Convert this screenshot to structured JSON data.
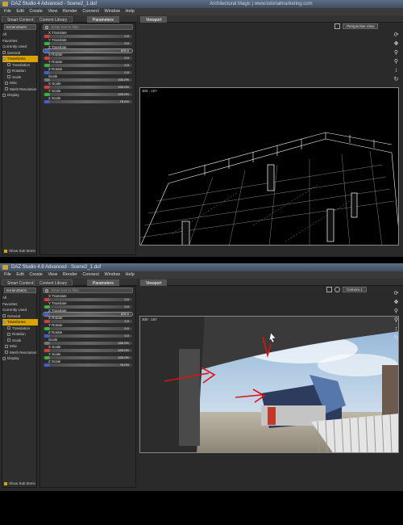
{
  "top": {
    "title": "DAZ Studio 4 Advanced - Scene2_1.duf",
    "watermark": "Architectural Magic | www.tutorialmarketing.com",
    "menus": [
      "File",
      "Edit",
      "Create",
      "View",
      "Render",
      "Connect",
      "Window",
      "Help"
    ],
    "tabs": [
      "Smart Content",
      "Content Library",
      "Parameters"
    ],
    "viewport_tab": "Viewport",
    "camera": "Perspective View",
    "viewport_size": "300 : 157",
    "selector_value": "terrain26a01",
    "search_placeholder": "Enter text to filter",
    "tree": [
      "All",
      "Favorites",
      "Currently Used",
      "General",
      "Transforms",
      "Translation",
      "Rotation",
      "Scale",
      "Misc",
      "Mesh Resolution",
      "Display"
    ],
    "show_sub": "Show Sub Items",
    "params": [
      {
        "label": "X Translate",
        "value": "0.0",
        "color": "#d04040"
      },
      {
        "label": "Y Translate",
        "value": "0.0",
        "color": "#40b040"
      },
      {
        "label": "Z Translate",
        "value": "839.0",
        "color": "#4060d0"
      },
      {
        "label": "X Rotate",
        "value": "0.0",
        "color": "#d04040"
      },
      {
        "label": "Y Rotate",
        "value": "0.0",
        "color": "#40b040"
      },
      {
        "label": "Z Rotate",
        "value": "0.0",
        "color": "#4060d0"
      },
      {
        "label": "Scale",
        "value": "100.0%",
        "color": "#777777"
      },
      {
        "label": "X Scale",
        "value": "100.0%",
        "color": "#d04040"
      },
      {
        "label": "Y Scale",
        "value": "100.0%",
        "color": "#40b040"
      },
      {
        "label": "Z Scale",
        "value": "76.0%",
        "color": "#4060d0"
      }
    ]
  },
  "bottom": {
    "title": "DAZ Studio 4.8 Advanced - Scene2_1.duf",
    "menus": [
      "File",
      "Edit",
      "Create",
      "View",
      "Render",
      "Connect",
      "Window",
      "Help"
    ],
    "tabs": [
      "Smart Content",
      "Content Library",
      "Parameters"
    ],
    "viewport_tab": "Viewport",
    "camera": "Camera 1",
    "viewport_size": "300 : 157",
    "selector_value": "terrain26a01",
    "search_placeholder": "Enter text to filter",
    "tree": [
      "All",
      "Favorites",
      "Currently Used",
      "General",
      "Transforms",
      "Translation",
      "Rotation",
      "Scale",
      "Misc",
      "Mesh Resolution",
      "Display"
    ],
    "show_sub": "Show Sub Items",
    "params": [
      {
        "label": "X Translate",
        "value": "0.0",
        "color": "#d04040"
      },
      {
        "label": "Y Translate",
        "value": "0.0",
        "color": "#40b040"
      },
      {
        "label": "Z Translate",
        "value": "839.0",
        "color": "#4060d0"
      },
      {
        "label": "X Rotate",
        "value": "0.0",
        "color": "#d04040"
      },
      {
        "label": "Y Rotate",
        "value": "0.0",
        "color": "#40b040"
      },
      {
        "label": "Z Rotate",
        "value": "0.0",
        "color": "#4060d0"
      },
      {
        "label": "Scale",
        "value": "100.0%",
        "color": "#777777"
      },
      {
        "label": "X Scale",
        "value": "100.0%",
        "color": "#d04040"
      },
      {
        "label": "Y Scale",
        "value": "100.0%",
        "color": "#40b040"
      },
      {
        "label": "Z Scale",
        "value": "76.0%",
        "color": "#4060d0"
      }
    ]
  }
}
